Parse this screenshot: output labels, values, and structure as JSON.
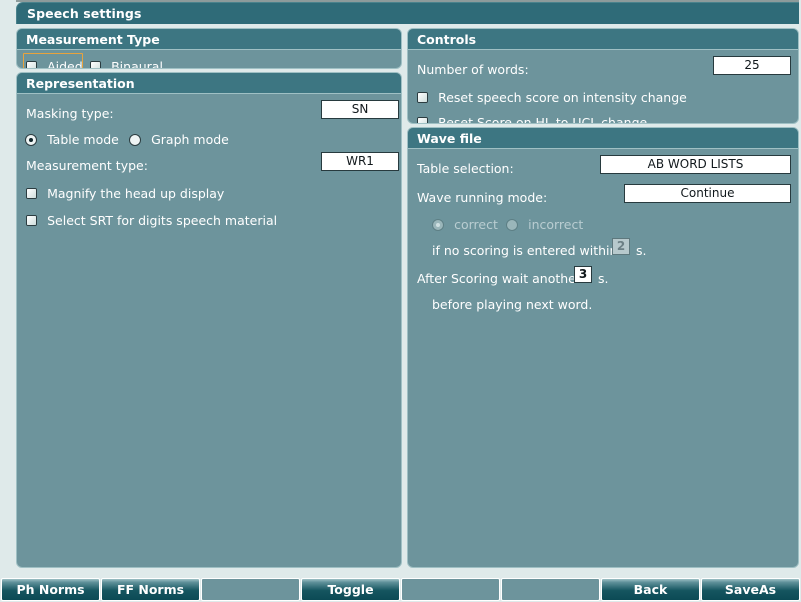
{
  "window": {
    "title": "Speech settings"
  },
  "groups": {
    "measurement_type": {
      "title": "Measurement Type",
      "checkboxes": [
        {
          "label": "Aided",
          "checked": false,
          "focused": true
        },
        {
          "label": "Binaural",
          "checked": false,
          "focused": false
        }
      ]
    },
    "representation": {
      "title": "Representation",
      "masking_type_label": "Masking type:",
      "masking_type_value": "SN",
      "mode_radios": [
        {
          "label": "Table mode",
          "selected": true
        },
        {
          "label": "Graph mode",
          "selected": false
        }
      ],
      "measurement_type_label": "Measurement type:",
      "measurement_type_value": "WR1",
      "checkboxes": [
        {
          "label": "Magnify the head up display",
          "checked": false
        },
        {
          "label": "Select SRT for digits speech material",
          "checked": false
        }
      ]
    },
    "controls": {
      "title": "Controls",
      "number_of_words_label": "Number of words:",
      "number_of_words_value": "25",
      "checkboxes": [
        {
          "label": "Reset speech score on intensity change",
          "checked": false
        },
        {
          "label": "Reset Score on HL to UCL change",
          "checked": false
        }
      ]
    },
    "wave_file": {
      "title": "Wave file",
      "table_selection_label": "Table selection:",
      "table_selection_value": "AB WORD LISTS",
      "wave_running_mode_label": "Wave running mode:",
      "wave_running_mode_value": "Continue",
      "scoring_radios": [
        {
          "label": "correct",
          "selected": true,
          "disabled": true
        },
        {
          "label": "incorrect",
          "selected": false,
          "disabled": true
        }
      ],
      "no_scoring_prefix": "if no scoring is entered within",
      "no_scoring_value": "2",
      "no_scoring_suffix": "s.",
      "after_scoring_prefix": "After Scoring wait another",
      "after_scoring_value": "3",
      "after_scoring_suffix": "s.",
      "before_playing_text": "before playing next word."
    }
  },
  "toolbar": {
    "buttons": [
      {
        "label": "Ph Norms",
        "empty": false
      },
      {
        "label": "FF Norms",
        "empty": false
      },
      {
        "label": "",
        "empty": true
      },
      {
        "label": "Toggle",
        "empty": false
      },
      {
        "label": "",
        "empty": true
      },
      {
        "label": "",
        "empty": true
      },
      {
        "label": "Back",
        "empty": false
      },
      {
        "label": "SaveAs",
        "empty": false
      }
    ]
  },
  "colors": {
    "window_background": "#dfeaea",
    "panel_background": "#6d949c",
    "title_bar": "#2f6b78",
    "panel_header": "#3d7682",
    "focus_orange": "#e8a33d",
    "field_background": "#ffffff"
  }
}
